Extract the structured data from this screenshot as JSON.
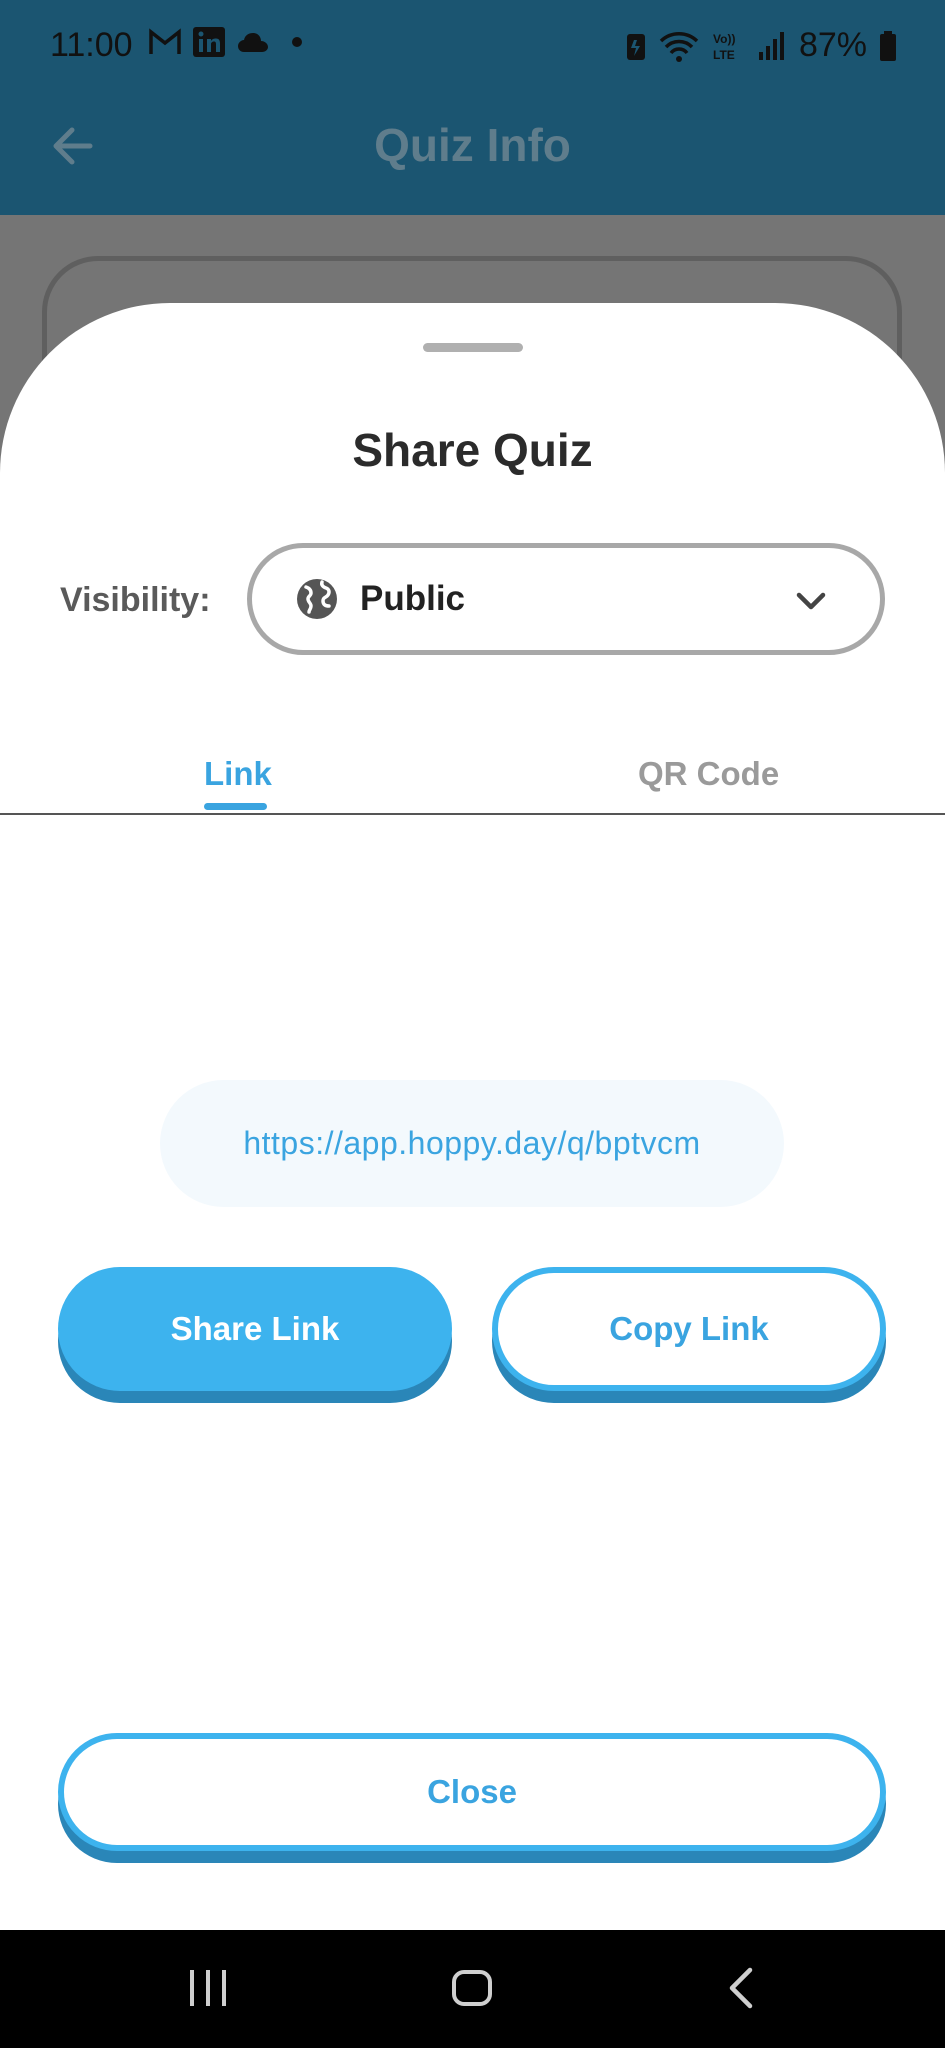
{
  "status_bar": {
    "time": "11:00",
    "battery": "87%",
    "app_icons": [
      "gmail-icon",
      "linkedin-icon",
      "cloud-icon",
      "dot-icon"
    ],
    "system_icons": [
      "battery-saver-icon",
      "wifi-icon",
      "volte-icon",
      "signal-icon",
      "battery-icon"
    ]
  },
  "app_bar": {
    "title": "Quiz Info"
  },
  "sheet": {
    "title": "Share Quiz",
    "visibility_label": "Visibility:",
    "visibility_value": "Public",
    "tabs": [
      {
        "label": "Link",
        "active": true
      },
      {
        "label": "QR Code",
        "active": false
      }
    ],
    "link_url": "https://app.hoppy.day/q/bptvcm",
    "share_button": "Share Link",
    "copy_button": "Copy Link",
    "close_button": "Close"
  },
  "colors": {
    "accent": "#3db3ee",
    "accent_dark": "#2a86b8",
    "app_bar": "#1b5571",
    "scrim": "#757575"
  }
}
